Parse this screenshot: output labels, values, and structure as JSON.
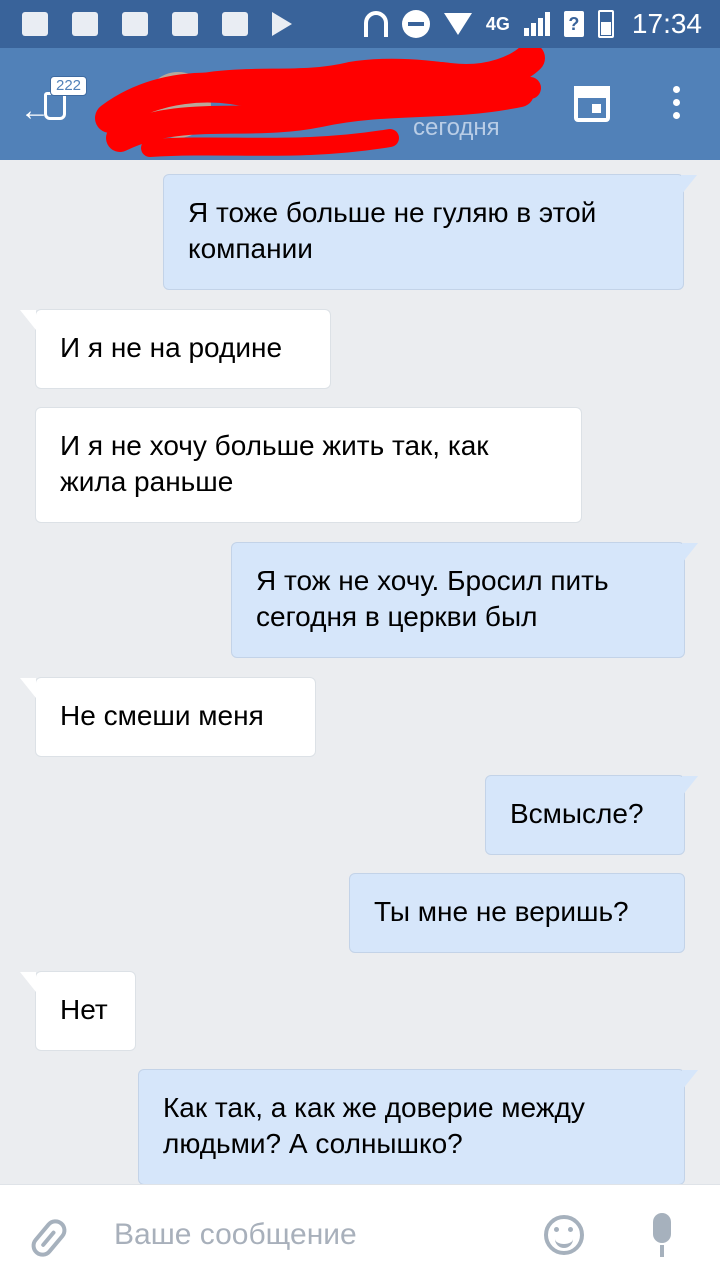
{
  "status_bar": {
    "network": "4G",
    "time": "17:34"
  },
  "header": {
    "unread_badge": "222",
    "chat_name": "",
    "chat_status": "сегодня"
  },
  "messages": [
    {
      "direction": "out",
      "text": "Я тоже больше не гуляю в этой компании"
    },
    {
      "direction": "in",
      "text": "И я не на родине"
    },
    {
      "direction": "in",
      "text": "И я не хочу больше жить так, как жила раньше"
    },
    {
      "direction": "out",
      "text": "Я тож не хочу. Бросил пить сегодня в церкви был"
    },
    {
      "direction": "in",
      "text": "Не смеши меня"
    },
    {
      "direction": "out",
      "text": "Всмысле?"
    },
    {
      "direction": "out",
      "text": "Ты мне не веришь?"
    },
    {
      "direction": "in",
      "text": "Нет"
    },
    {
      "direction": "out",
      "text": "Как так, а как же доверие между людьми? А солнышко?"
    }
  ],
  "composer": {
    "placeholder": "Ваше сообщение",
    "value": ""
  },
  "colors": {
    "status_bar": "#39639a",
    "header": "#5181b8",
    "background": "#ebedf0",
    "outgoing_bubble": "#d6e6fa",
    "incoming_bubble": "#ffffff",
    "redaction": "#ff0000"
  },
  "icons": {
    "back": "back-arrow-icon",
    "calendar": "calendar-icon",
    "more": "more-vertical-icon",
    "attach": "paperclip-icon",
    "emoji": "smiley-icon",
    "voice": "microphone-icon"
  }
}
